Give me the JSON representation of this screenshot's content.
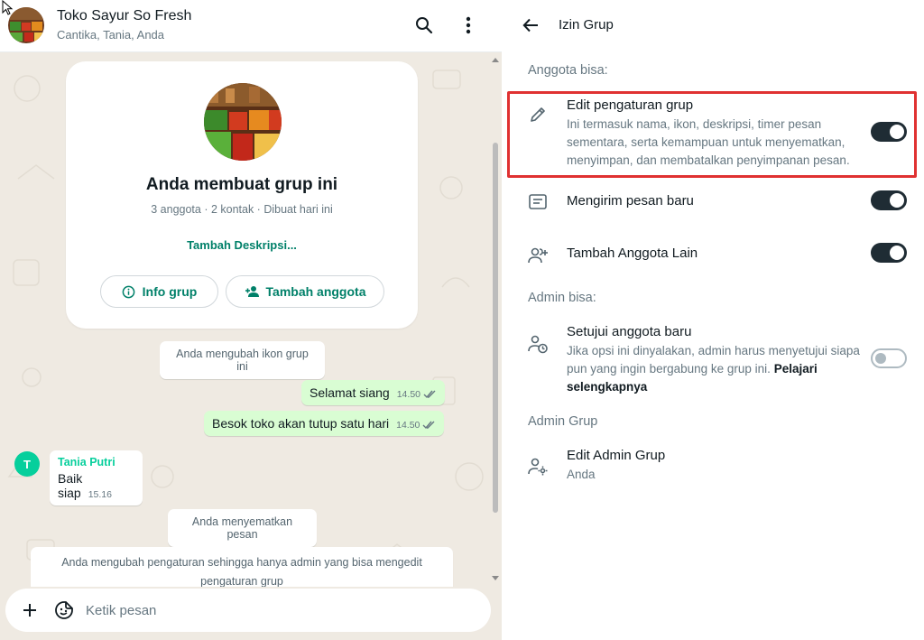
{
  "chat": {
    "header": {
      "title": "Toko Sayur So Fresh",
      "subtitle": "Cantika, Tania, Anda",
      "search_icon": "search-icon",
      "menu_icon": "more-vertical-icon"
    },
    "intro_card": {
      "title": "Anda membuat grup ini",
      "meta": "3 anggota · 2 kontak · Dibuat hari ini",
      "add_description": "Tambah Deskripsi...",
      "info_button": "Info grup",
      "add_member_button": "Tambah anggota"
    },
    "messages": [
      {
        "type": "system",
        "text": "Anda mengubah ikon grup ini"
      },
      {
        "type": "outgoing",
        "text": "Selamat siang",
        "time": "14.50"
      },
      {
        "type": "outgoing",
        "text": "Besok toko akan tutup satu hari",
        "time": "14.50"
      },
      {
        "type": "incoming",
        "sender": "Tania Putri",
        "avatar_letter": "T",
        "text": "Baik siap",
        "time": "15.16"
      },
      {
        "type": "system",
        "text": "Anda menyematkan pesan"
      },
      {
        "type": "system",
        "text": "Anda mengubah pengaturan sehingga hanya admin yang bisa mengedit pengaturan grup"
      }
    ],
    "composer": {
      "placeholder": "Ketik pesan",
      "attach_icon": "plus-icon",
      "sticker_icon": "sticker-icon"
    }
  },
  "settings": {
    "title": "Izin Grup",
    "members_can_label": "Anggota bisa:",
    "admins_can_label": "Admin bisa:",
    "admin_group_label": "Admin Grup",
    "items": [
      {
        "title": "Edit pengaturan grup",
        "description": "Ini termasuk nama, ikon, deskripsi, timer pesan sementara, serta kemampuan untuk menyematkan, menyimpan, dan membatalkan penyimpanan pesan.",
        "enabled": true,
        "icon": "pencil-icon"
      },
      {
        "title": "Mengirim pesan baru",
        "enabled": true,
        "icon": "message-icon"
      },
      {
        "title": "Tambah Anggota Lain",
        "enabled": true,
        "icon": "add-members-icon"
      },
      {
        "title": "Setujui anggota baru",
        "description": "Jika opsi ini dinyalakan, admin harus menyetujui siapa pun yang ingin bergabung ke grup ini.",
        "link": "Pelajari selengkapnya",
        "enabled": false,
        "icon": "approve-member-icon"
      }
    ],
    "edit_admin": {
      "title": "Edit Admin Grup",
      "subtitle": "Anda",
      "icon": "admin-settings-icon"
    }
  },
  "colors": {
    "accent": "#008069",
    "outgoing_bubble": "#d9fdd3",
    "chat_background": "#efeae2",
    "toggle_on": "#1f2c34",
    "highlight": "#e03131",
    "sender_name": "#06cf9c"
  }
}
